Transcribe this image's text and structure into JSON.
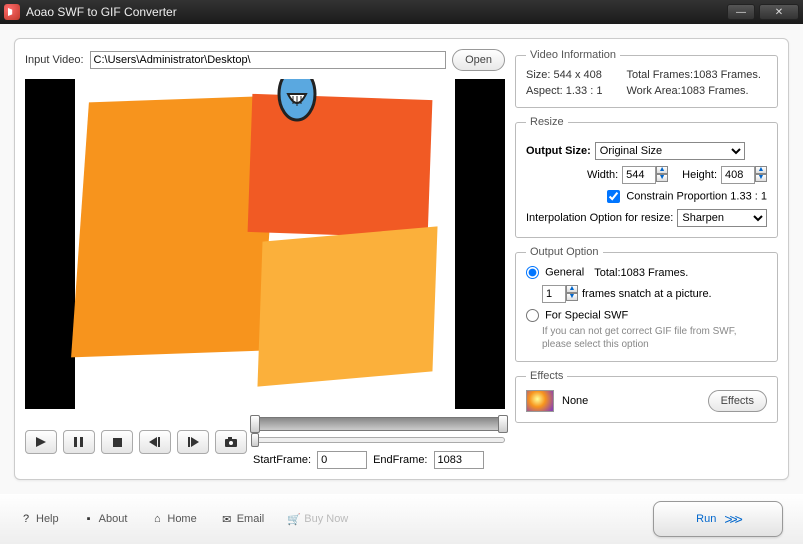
{
  "titlebar": {
    "title": "Aoao SWF to GIF Converter"
  },
  "input": {
    "label": "Input Video:",
    "path": "C:\\Users\\Administrator\\Desktop\\",
    "open_btn": "Open"
  },
  "video_info": {
    "legend": "Video Information",
    "size_label": "Size:",
    "size_value": "544 x 408",
    "total_frames_label": "Total Frames:",
    "total_frames_value": "1083 Frames.",
    "aspect_label": "Aspect:",
    "aspect_value": "1.33 : 1",
    "work_area_label": "Work Area:",
    "work_area_value": "1083 Frames."
  },
  "resize": {
    "legend": "Resize",
    "output_size_label": "Output Size:",
    "output_size_value": "Original Size",
    "width_label": "Width:",
    "width_value": "544",
    "height_label": "Height:",
    "height_value": "408",
    "constrain_label": "Constrain Proportion  1.33 : 1",
    "interp_label": "Interpolation Option for resize:",
    "interp_value": "Sharpen"
  },
  "output": {
    "legend": "Output Option",
    "general_label": "General",
    "total_label": "Total:1083 Frames.",
    "snatch_value": "1",
    "snatch_label": "frames snatch at a picture.",
    "special_label": "For Special SWF",
    "special_hint": "If you can not get correct GIF file from SWF, please select this option"
  },
  "effects": {
    "legend": "Effects",
    "name": "None",
    "btn": "Effects"
  },
  "frames": {
    "start_label": "StartFrame:",
    "start_value": "0",
    "end_label": "EndFrame:",
    "end_value": "1083"
  },
  "footer": {
    "help": "Help",
    "about": "About",
    "home": "Home",
    "email": "Email",
    "buy": "Buy Now",
    "run": "Run"
  }
}
